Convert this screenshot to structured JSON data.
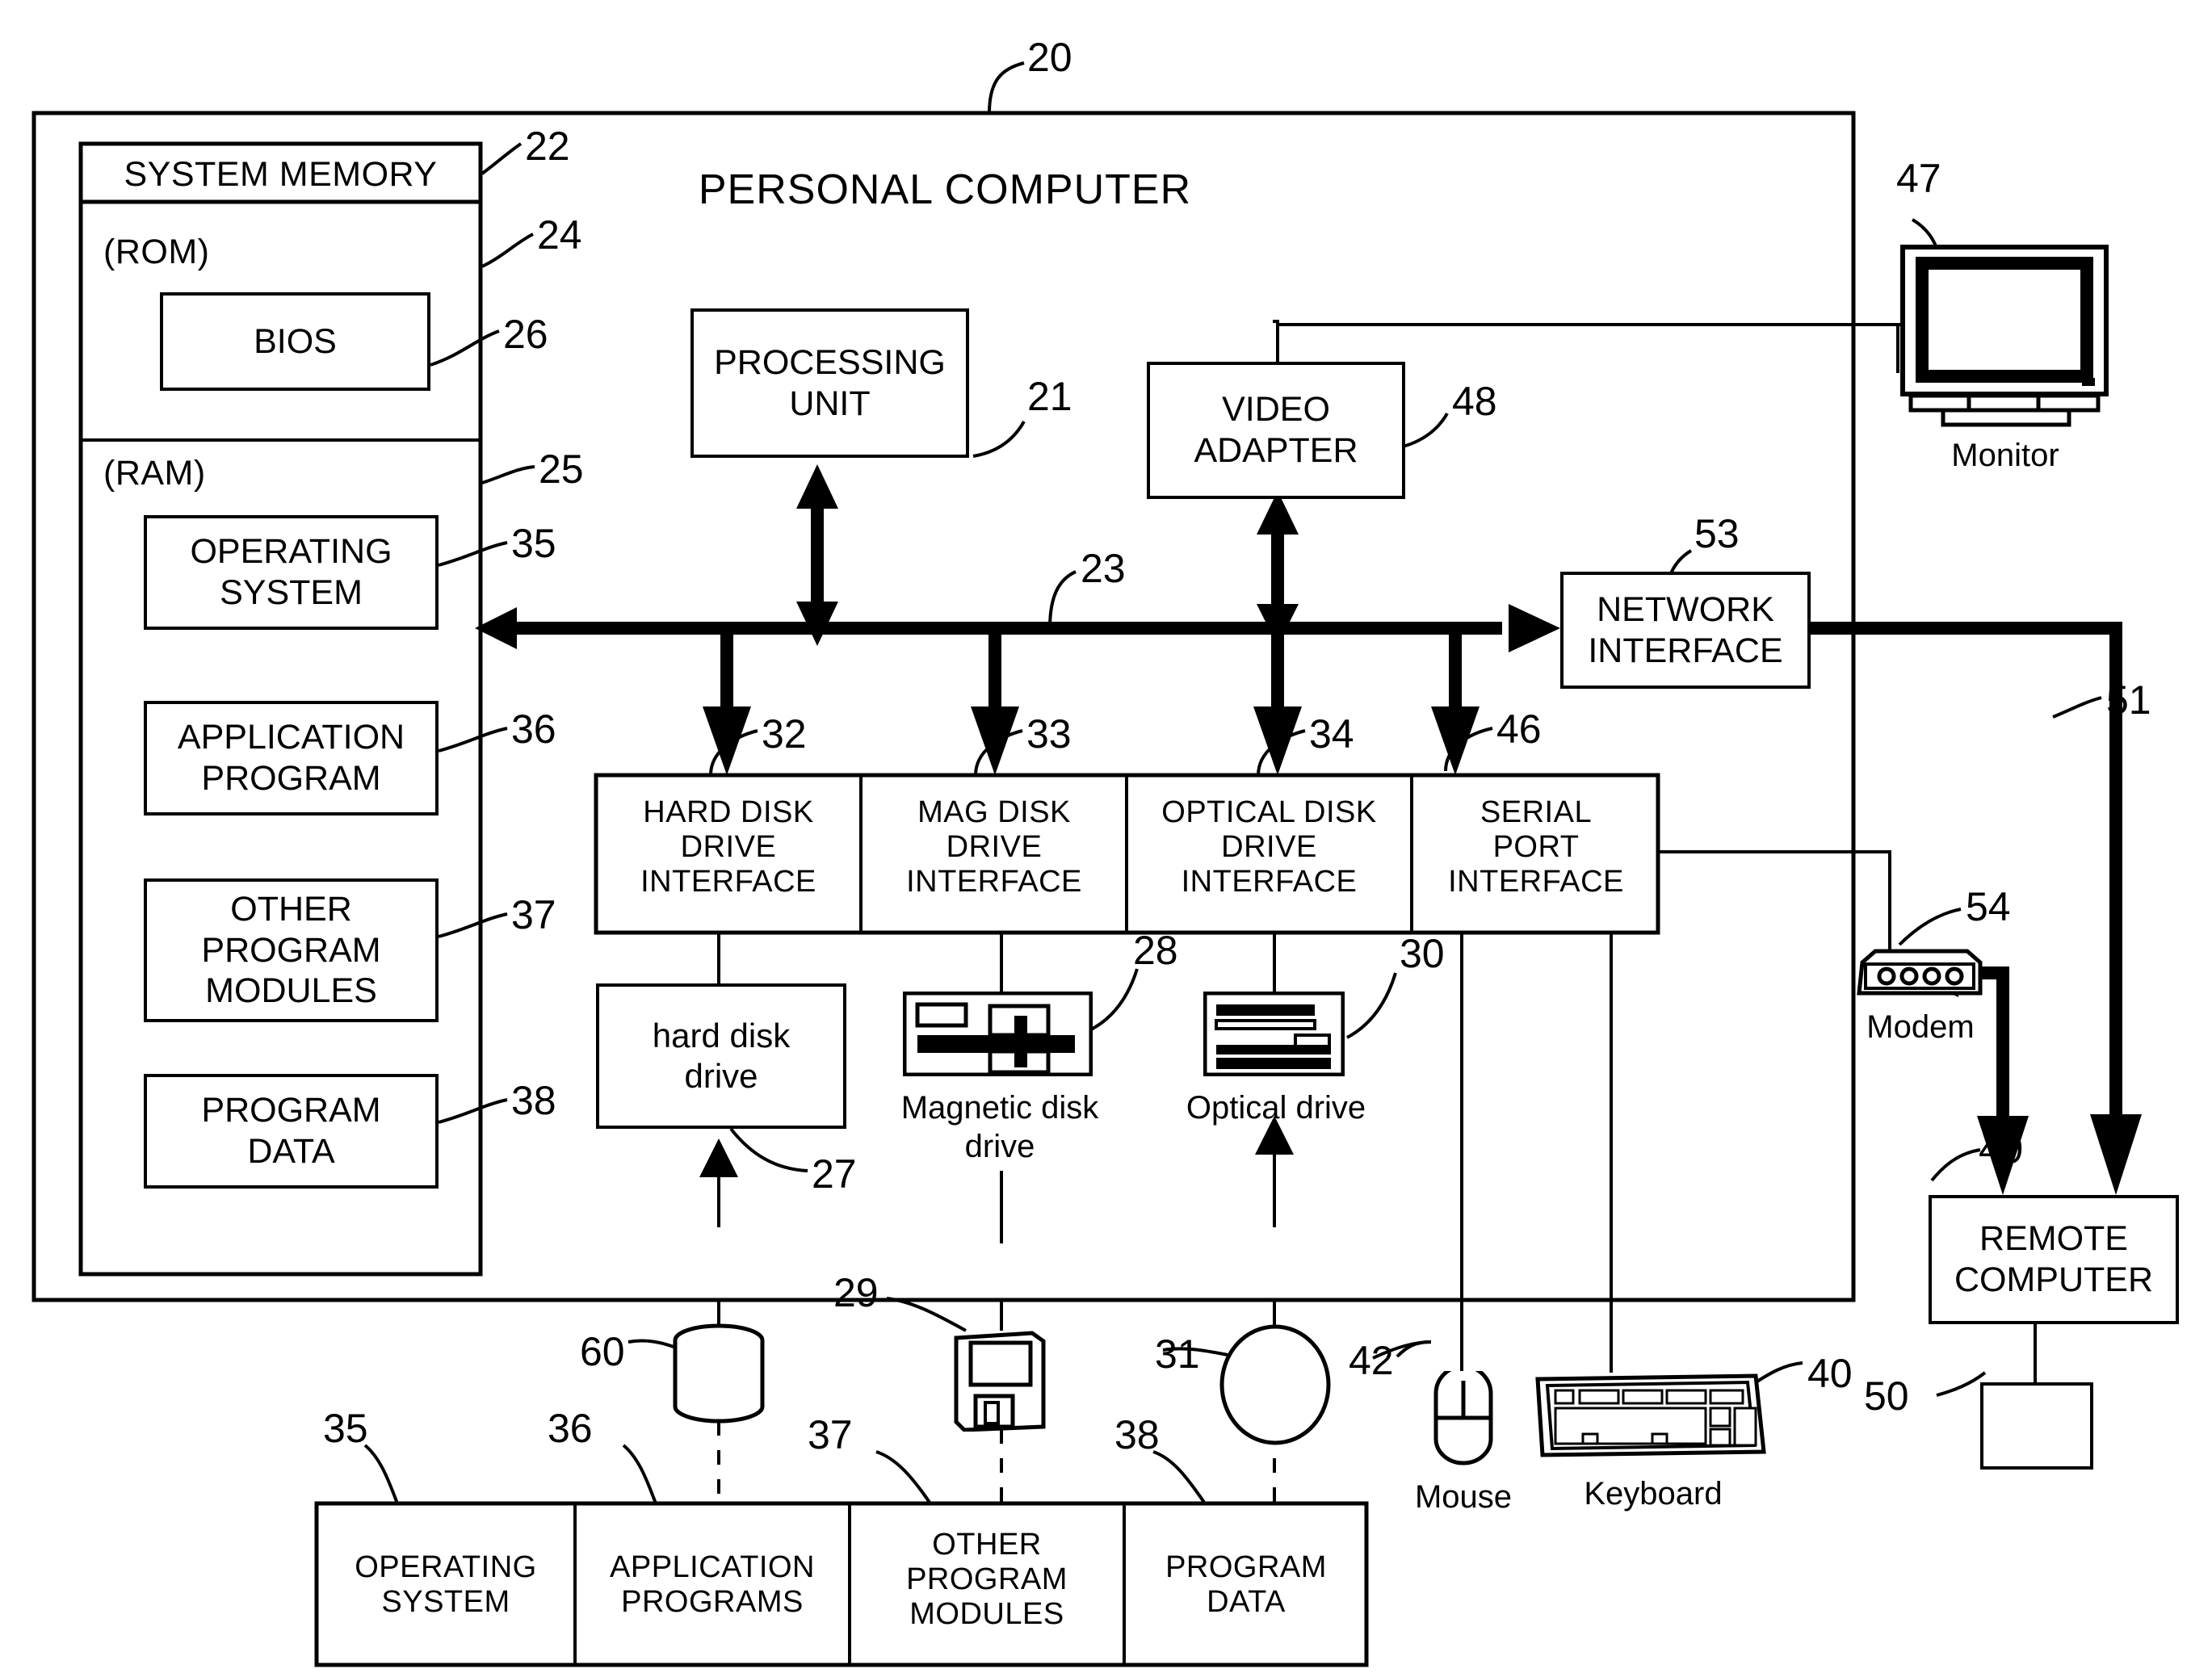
{
  "figure": {
    "title": "PERSONAL COMPUTER",
    "outer_ref": "20"
  },
  "memory": {
    "header": "SYSTEM MEMORY",
    "header_ref": "22",
    "rom_label": "(ROM)",
    "rom_ref": "24",
    "bios_label": "BIOS",
    "bios_ref": "26",
    "ram_label": "(RAM)",
    "ram_ref": "25",
    "items": [
      {
        "label": "OPERATING\nSYSTEM",
        "ref": "35"
      },
      {
        "label": "APPLICATION\nPROGRAM",
        "ref": "36"
      },
      {
        "label": "OTHER\nPROGRAM\nMODULES",
        "ref": "37"
      },
      {
        "label": "PROGRAM\nDATA",
        "ref": "38"
      }
    ]
  },
  "core": {
    "processing_unit": {
      "label": "PROCESSING\nUNIT",
      "ref": "21"
    },
    "video_adapter": {
      "label": "VIDEO\nADAPTER",
      "ref": "48"
    },
    "bus_ref": "23",
    "network_interface": {
      "label": "NETWORK\nINTERFACE",
      "ref": "53"
    }
  },
  "interfaces": [
    {
      "label": "HARD DISK\nDRIVE\nINTERFACE",
      "ref": "32"
    },
    {
      "label": "MAG DISK\nDRIVE\nINTERFACE",
      "ref": "33"
    },
    {
      "label": "OPTICAL DISK\nDRIVE\nINTERFACE",
      "ref": "34"
    },
    {
      "label": "SERIAL\nPORT\nINTERFACE",
      "ref": "46"
    }
  ],
  "drives": {
    "hard_disk": {
      "label": "hard disk\ndrive",
      "ref": "27"
    },
    "magnetic_disk": {
      "label": "Magnetic disk\ndrive",
      "ref": "28"
    },
    "optical": {
      "label": "Optical drive",
      "ref": "30"
    }
  },
  "media": {
    "hard_disk_platter_ref": "60",
    "floppy_ref": "29",
    "optical_disc_ref": "31"
  },
  "peripherals": {
    "monitor": {
      "label": "Monitor",
      "ref": "47"
    },
    "mouse": {
      "label": "Mouse",
      "ref": "42"
    },
    "keyboard": {
      "label": "Keyboard",
      "ref": "40"
    },
    "modem": {
      "label": "Modem",
      "ref": "54"
    }
  },
  "remote": {
    "computer": {
      "label": "REMOTE\nCOMPUTER",
      "ref": "49"
    },
    "memory_ref": "50",
    "wan_ref": "51"
  },
  "storage_row": [
    {
      "label": "OPERATING\nSYSTEM",
      "ref": "35"
    },
    {
      "label": "APPLICATION\nPROGRAMS",
      "ref": "36"
    },
    {
      "label": "OTHER\nPROGRAM\nMODULES",
      "ref": "37"
    },
    {
      "label": "PROGRAM\nDATA",
      "ref": "38"
    }
  ]
}
